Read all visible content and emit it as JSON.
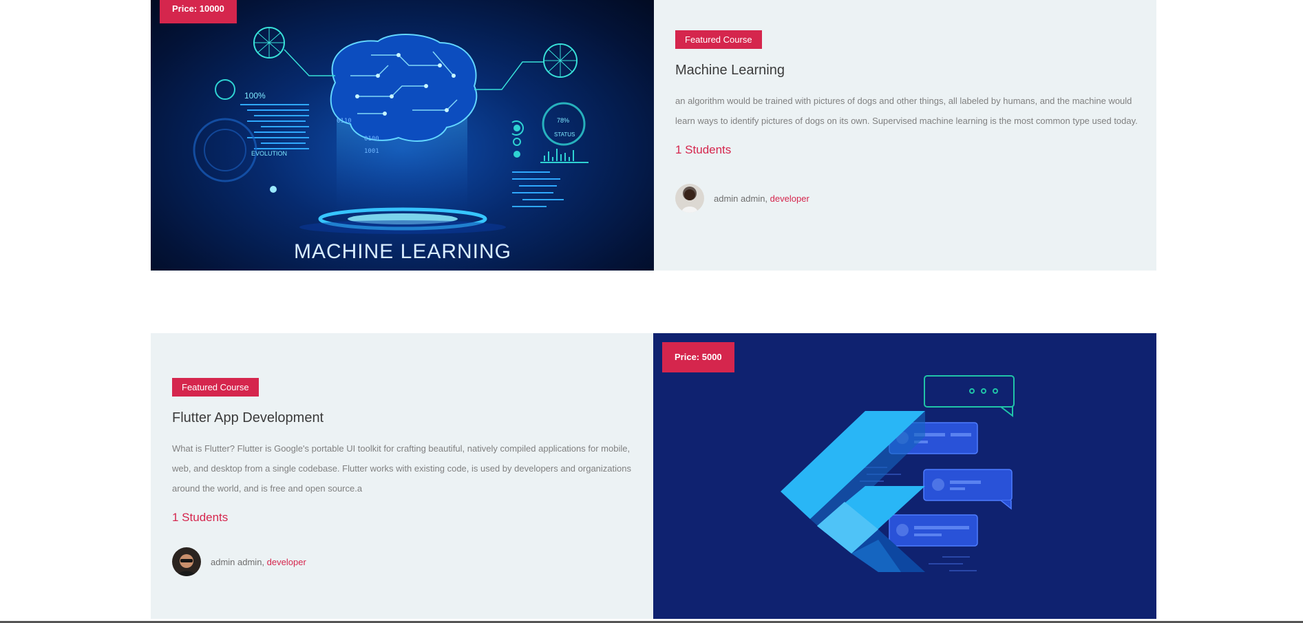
{
  "courses": [
    {
      "price": "Price: 10000",
      "badge": "Featured Course",
      "title": "Machine Learning",
      "description": "an algorithm would be trained with pictures of dogs and other things, all labeled by humans, and the machine would learn ways to identify pictures of dogs on its own. Supervised machine learning is the most common type used today.",
      "students": "1 Students",
      "author_name": "admin admin,",
      "author_role": "developer",
      "image_caption": "MACHINE LEARNING",
      "image_text": [
        "100%",
        "EVOLUTION",
        "78%",
        "STATUS",
        "0110",
        "0100",
        "1001"
      ]
    },
    {
      "price": "Price: 5000",
      "badge": "Featured Course",
      "title": "Flutter App Development",
      "description": "What is Flutter? Flutter is Google's portable UI toolkit for crafting beautiful, natively compiled applications for mobile, web, and desktop from a single codebase. Flutter works with existing code, is used by developers and organizations around the world, and is free and open source.a",
      "students": "1 Students",
      "author_name": "admin admin,",
      "author_role": "developer"
    }
  ],
  "colors": {
    "accent": "#d5264d",
    "card_bg": "#ecf2f4",
    "flutter_bg": "#0f2270"
  }
}
